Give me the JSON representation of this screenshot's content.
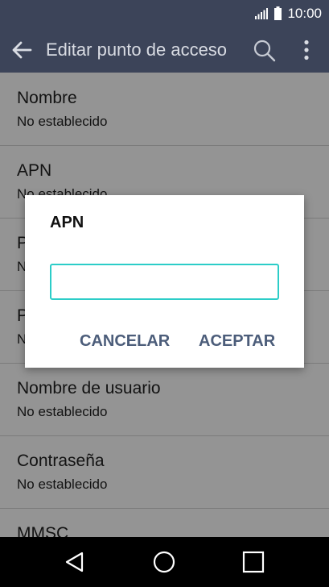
{
  "status_bar": {
    "time": "10:00"
  },
  "app_bar": {
    "title": "Editar punto de acceso",
    "back_icon": "arrow-left-icon",
    "search_icon": "search-icon",
    "more_icon": "more-vertical-icon"
  },
  "settings": [
    {
      "title": "Nombre",
      "summary": "No establecido"
    },
    {
      "title": "APN",
      "summary": "No establecido"
    },
    {
      "title": "P",
      "summary": "N"
    },
    {
      "title": "P",
      "summary": "N"
    },
    {
      "title": "Nombre de usuario",
      "summary": "No establecido"
    },
    {
      "title": "Contraseña",
      "summary": "No establecido"
    },
    {
      "title": "MMSC",
      "summary": ""
    }
  ],
  "dialog": {
    "title": "APN",
    "input_value": "",
    "cancel_label": "CANCELAR",
    "accept_label": "ACEPTAR"
  },
  "colors": {
    "app_bar": "#3c4459",
    "accent": "#2ccdc8",
    "dialog_button": "#4c5d7a"
  }
}
